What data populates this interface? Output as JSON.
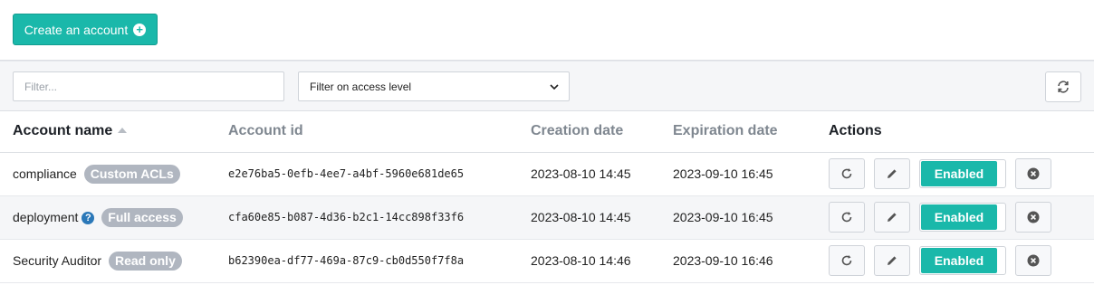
{
  "toolbar": {
    "create_label": "Create an account"
  },
  "filters": {
    "search_placeholder": "Filter...",
    "access_level_selected": "Filter on access level"
  },
  "table": {
    "headers": {
      "name": "Account name",
      "id": "Account id",
      "created": "Creation date",
      "expires": "Expiration date",
      "actions": "Actions"
    },
    "rows": [
      {
        "name": "compliance",
        "badge": "Custom ACLs",
        "help": false,
        "id": "e2e76ba5-0efb-4ee7-a4bf-5960e681de65",
        "created": "2023-08-10 14:45",
        "expires": "2023-09-10 16:45",
        "status": "Enabled"
      },
      {
        "name": "deployment",
        "badge": "Full access",
        "help": true,
        "id": "cfa60e85-b087-4d36-b2c1-14cc898f33f6",
        "created": "2023-08-10 14:45",
        "expires": "2023-09-10 16:45",
        "status": "Enabled"
      },
      {
        "name": "Security Auditor",
        "badge": "Read only",
        "help": false,
        "id": "b62390ea-df77-469a-87c9-cb0d550f7f8a",
        "created": "2023-08-10 14:46",
        "expires": "2023-09-10 16:46",
        "status": "Enabled"
      }
    ]
  },
  "colors": {
    "accent": "#1ab8aa",
    "badge": "#b0b6c0",
    "help": "#2b78b8"
  },
  "icons": {
    "create": "plus-circle-icon",
    "refresh": "refresh-icon",
    "regenerate": "rotate-icon",
    "edit": "pencil-icon",
    "delete": "close-circle-icon",
    "sort": "sort-up-icon"
  }
}
